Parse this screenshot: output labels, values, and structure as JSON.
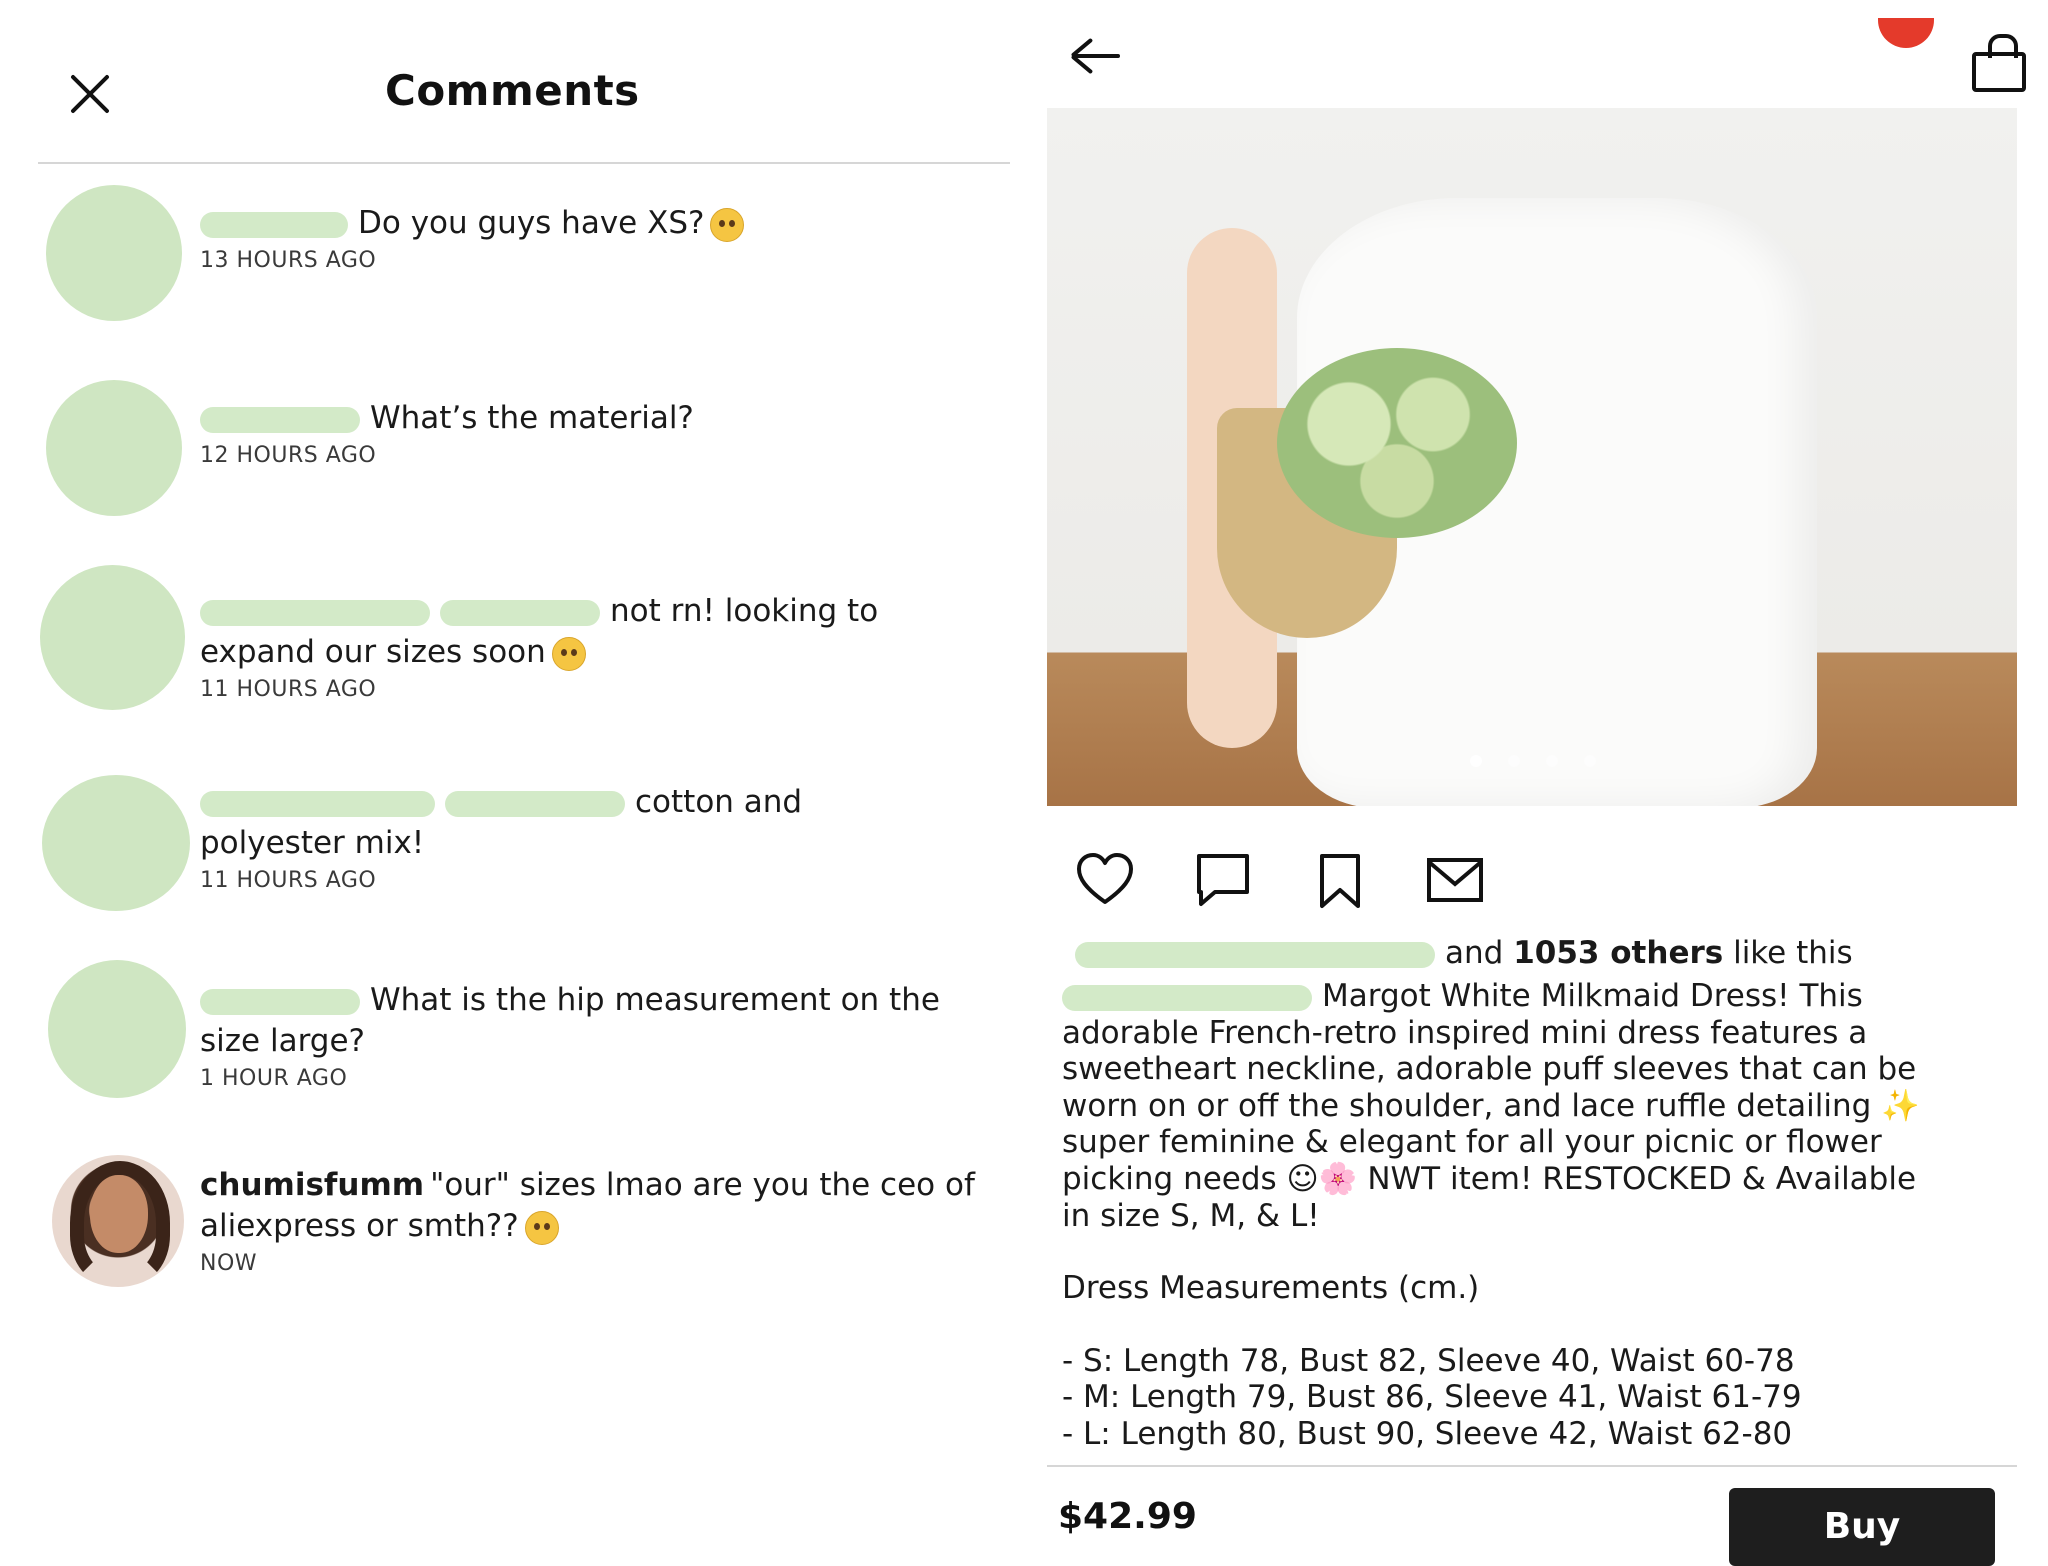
{
  "comments_panel": {
    "title": "Comments",
    "items": [
      {
        "user": "",
        "text": "Do you guys have XS?",
        "time": "13 HOURS AGO"
      },
      {
        "user": "",
        "text": "What’s the material?",
        "time": "12 HOURS AGO"
      },
      {
        "user": "",
        "text": "not rn! looking to expand our sizes soon",
        "time": "11 HOURS AGO"
      },
      {
        "user": "",
        "text": "cotton and polyester mix!",
        "time": "11 HOURS AGO"
      },
      {
        "user": "",
        "text": "What is the hip measurement on the size large?",
        "time": "1 HOUR AGO"
      },
      {
        "user": "chumisfumm",
        "text": "\"our\" sizes lmao are you the ceo of aliexpress or smth??",
        "time": "NOW"
      }
    ]
  },
  "product": {
    "icons": {
      "back": "back-arrow-icon",
      "bag": "shopping-bag-icon",
      "heart": "heart-icon",
      "comment": "comment-icon",
      "bookmark": "bookmark-icon",
      "share": "mail-icon"
    },
    "carousel": {
      "count": 4,
      "active": 1
    },
    "likes": {
      "prefix": "and",
      "count_text": "1053 others",
      "suffix": "like this"
    },
    "description_lines": [
      "Margot White Milkmaid Dress! This",
      "adorable French-retro inspired mini dress features a",
      "sweetheart neckline, adorable puff sleeves that can be",
      "worn on or off the shoulder, and lace ruffle detailing ✨",
      "super feminine & elegant for all your picnic or flower",
      "picking needs ☺🌸 NWT item! RESTOCKED & Available",
      "in size S, M, & L!"
    ],
    "measurements_title": "Dress Measurements (cm.)",
    "measurements": [
      "- S: Length 78, Bust 82, Sleeve 40, Waist 60-78",
      "- M: Length 79, Bust 86, Sleeve 41, Waist 61-79",
      "- L: Length 80, Bust 90, Sleeve 42, Waist 62-80"
    ],
    "price": "$42.99",
    "buy_label": "Buy"
  },
  "colors": {
    "redaction": "#d3eac8",
    "badge": "#e43a2b",
    "buy_bg": "#1e1e1e"
  }
}
